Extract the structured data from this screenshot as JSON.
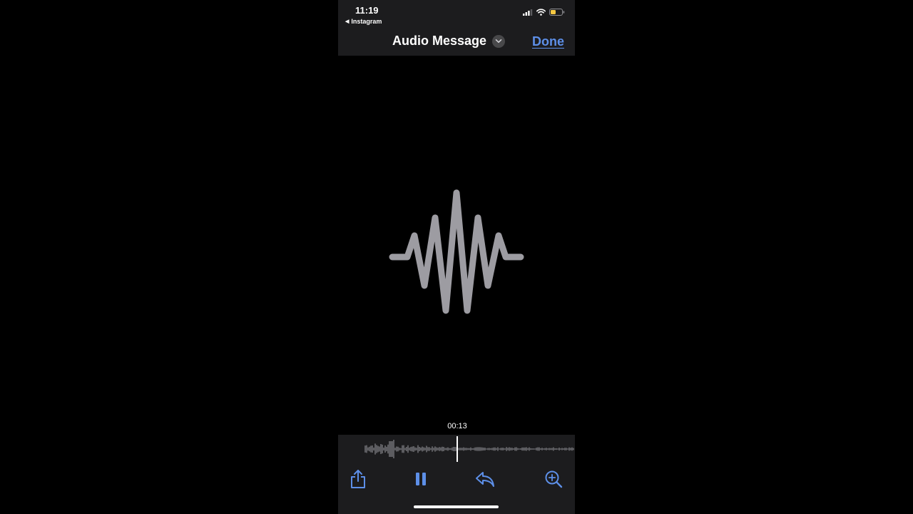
{
  "status_bar": {
    "time": "11:19",
    "back_label": "Instagram",
    "back_arrow": "◀"
  },
  "nav": {
    "title": "Audio Message",
    "done_label": "Done"
  },
  "player": {
    "current_time": "00:13"
  },
  "icons": {
    "back": "back-arrow-icon",
    "chevron": "chevron-down-icon",
    "signal": "signal-icon",
    "wifi": "wifi-icon",
    "battery": "battery-icon",
    "waveform": "waveform-icon",
    "share": "share-icon",
    "pause": "pause-icon",
    "reply": "reply-icon",
    "zoom": "zoom-in-icon"
  },
  "colors": {
    "accent": "#5d8fe8",
    "bar_background": "#1c1c1e",
    "waveform_gray": "#9d9ca2",
    "battery_yellow": "#f5c842"
  }
}
